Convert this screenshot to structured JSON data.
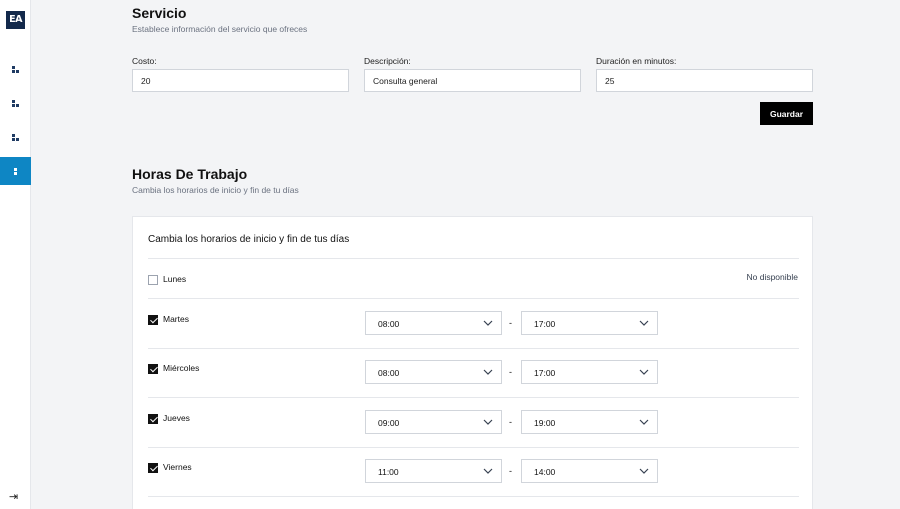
{
  "sidebar": {
    "logo": "EA",
    "items": [
      {
        "name": "nav-item-1",
        "active": false
      },
      {
        "name": "nav-item-2",
        "active": false
      },
      {
        "name": "nav-item-3",
        "active": false
      },
      {
        "name": "nav-item-4",
        "active": true
      }
    ],
    "logout_icon": "logout-icon",
    "accent_color": "#0e86c4",
    "logo_color": "#13294b"
  },
  "service": {
    "title": "Servicio",
    "subtitle": "Establece información del servicio que ofreces",
    "cost_label": "Costo:",
    "cost_value": "20",
    "description_label": "Descripción:",
    "description_value": "Consulta general",
    "duration_label": "Duración en minutos:",
    "duration_value": "25",
    "save_label": "Guardar"
  },
  "hours": {
    "title": "Horas De Trabajo",
    "subtitle": "Cambia los horarios de inicio y fin de tu días",
    "card_title": "Cambia los horarios de inicio y fin de tus días",
    "separator": "-",
    "days": [
      {
        "day": "Lunes",
        "enabled": false,
        "status": "No disponible"
      },
      {
        "day": "Martes",
        "enabled": true,
        "start": "08:00",
        "end": "17:00"
      },
      {
        "day": "Miércoles",
        "enabled": true,
        "start": "08:00",
        "end": "17:00"
      },
      {
        "day": "Jueves",
        "enabled": true,
        "start": "09:00",
        "end": "19:00"
      },
      {
        "day": "Viernes",
        "enabled": true,
        "start": "11:00",
        "end": "14:00"
      }
    ]
  }
}
